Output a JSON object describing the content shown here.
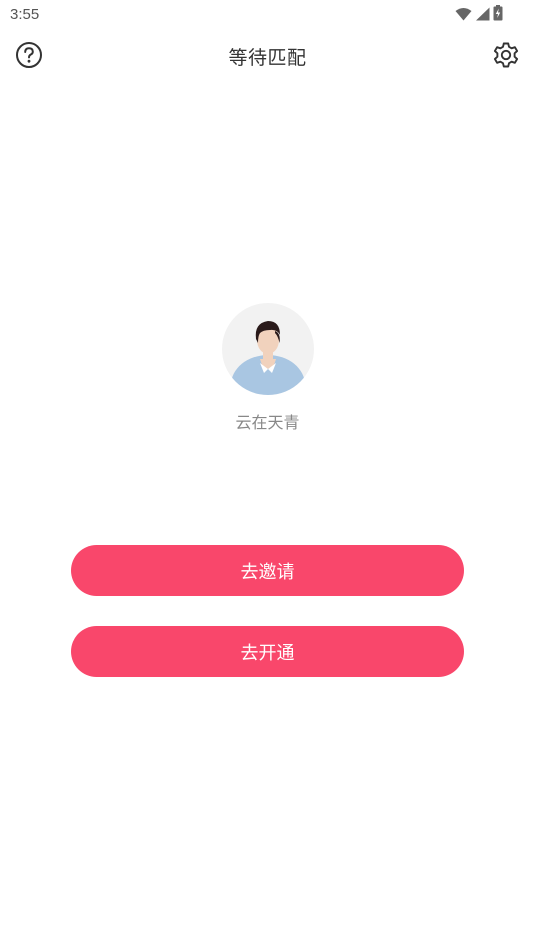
{
  "status_bar": {
    "time": "3:55",
    "icons": [
      "wifi-icon",
      "signal-icon",
      "battery-charging-icon"
    ]
  },
  "header": {
    "title": "等待匹配",
    "left_icon": "help-icon",
    "right_icon": "settings-icon"
  },
  "profile": {
    "avatar": "male-avatar",
    "name": "云在天青"
  },
  "actions": {
    "invite_label": "去邀请",
    "open_label": "去开通"
  },
  "colors": {
    "accent": "#f9476b",
    "avatar_bg": "#f2f2f2",
    "shirt": "#a9c6e2",
    "text_primary": "#333333",
    "text_secondary": "#888888"
  }
}
